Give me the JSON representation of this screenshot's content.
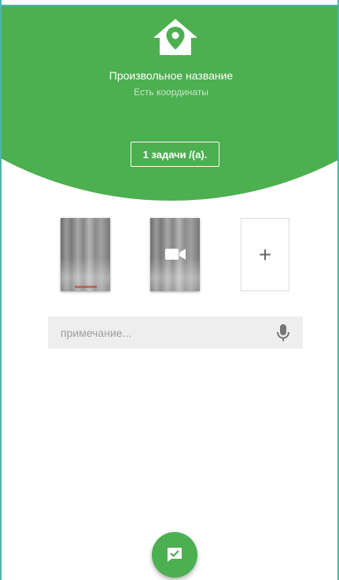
{
  "header": {
    "place_title": "Произвольное название",
    "coords_status": "Есть координаты",
    "tasks_button_label": "1 задачи /(а).",
    "icon": "home-pin-icon",
    "color": "#4caf50"
  },
  "media": {
    "items": [
      {
        "type": "photo",
        "icon": "photo-thumbnail"
      },
      {
        "type": "video",
        "icon": "video-camera-icon"
      }
    ],
    "add_label": "+"
  },
  "note": {
    "placeholder": "примечание...",
    "value": "",
    "icon": "mic-icon"
  },
  "fab": {
    "icon": "check-message-icon"
  },
  "colors": {
    "accent": "#4caf50",
    "frame": "#4db6ac"
  }
}
